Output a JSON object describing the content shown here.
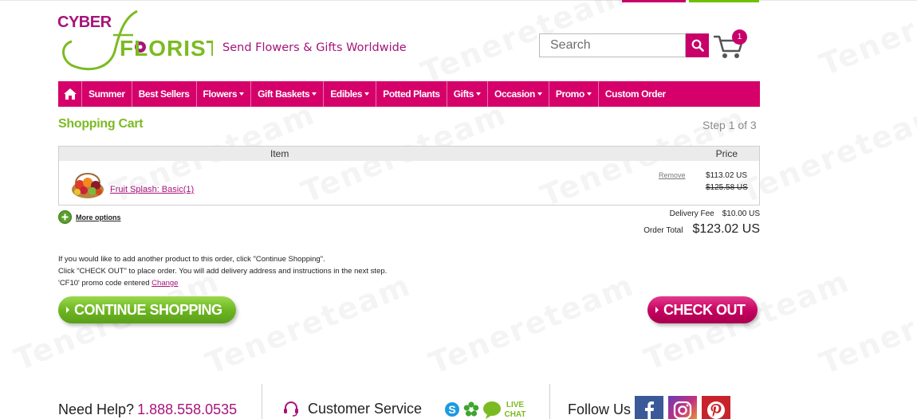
{
  "brand": {
    "logo_top": "CYBER",
    "logo_bottom": "FLORIST",
    "tagline": "Send Flowers & Gifts Worldwide",
    "colors": {
      "magenta": "#d5006a",
      "green": "#6cc100",
      "title_green": "#7bbb22"
    }
  },
  "header": {
    "search_placeholder": "Search",
    "search_icon": "magnifier-icon",
    "cart_icon": "shopping-cart-icon",
    "cart_count": "1"
  },
  "nav": {
    "home_icon": "home-icon",
    "items": [
      {
        "label": "Summer",
        "dropdown": false
      },
      {
        "label": "Best Sellers",
        "dropdown": false
      },
      {
        "label": "Flowers",
        "dropdown": true
      },
      {
        "label": "Gift Baskets",
        "dropdown": true
      },
      {
        "label": "Edibles",
        "dropdown": true
      },
      {
        "label": "Potted Plants",
        "dropdown": false
      },
      {
        "label": "Gifts",
        "dropdown": true
      },
      {
        "label": "Occasion",
        "dropdown": true
      },
      {
        "label": "Promo",
        "dropdown": true
      },
      {
        "label": "Custom Order",
        "dropdown": false
      }
    ]
  },
  "cart": {
    "title": "Shopping Cart",
    "step": "Step 1 of 3",
    "columns": {
      "item": "Item",
      "price": "Price"
    },
    "items": [
      {
        "name": "Fruit Splash: Basic(1)",
        "remove_label": "Remove",
        "price": "$113.02 US",
        "original_price": "$125.58 US"
      }
    ],
    "more_options": "More options",
    "delivery_label": "Delivery Fee",
    "delivery_value": "$10.00 US",
    "total_label": "Order Total",
    "total_value": "$123.02 US"
  },
  "notes": {
    "line1": "If you would like to add another product to this order, click \"Continue Shopping\".",
    "line2": "Click \"CHECK OUT\" to place order. You will add delivery address and instructions in the next step.",
    "promo_text": "'CF10' promo code entered",
    "promo_change": "Change"
  },
  "buttons": {
    "continue": "CONTINUE SHOPPING",
    "checkout": "CHECK OUT"
  },
  "footer": {
    "help_label": "Need Help?",
    "phone": "1.888.558.0535",
    "customer_service": "Customer Service",
    "chat_label_1": "LIVE",
    "chat_label_2": "CHAT",
    "follow_label": "Follow Us",
    "social": [
      "facebook-icon",
      "instagram-icon",
      "pinterest-icon"
    ],
    "social_colors": {
      "facebook": "#3b5998",
      "instagram": "#c1307f",
      "pinterest": "#c8232c"
    }
  },
  "watermark": "Tenereteam"
}
